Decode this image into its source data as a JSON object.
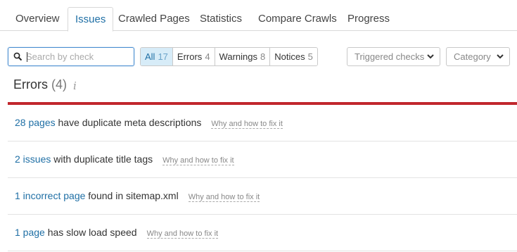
{
  "tabs": [
    {
      "label": "Overview"
    },
    {
      "label": "Issues"
    },
    {
      "label": "Crawled Pages"
    },
    {
      "label": "Statistics"
    },
    {
      "label": "Compare Crawls"
    },
    {
      "label": "Progress"
    }
  ],
  "search": {
    "placeholder": "Search by check"
  },
  "filters": [
    {
      "label": "All",
      "count": "17"
    },
    {
      "label": "Errors",
      "count": "4"
    },
    {
      "label": "Warnings",
      "count": "8"
    },
    {
      "label": "Notices",
      "count": "5"
    }
  ],
  "dropdowns": {
    "triggered": "Triggered checks",
    "category": "Category"
  },
  "section": {
    "title": "Errors",
    "count": "(4)",
    "info": "i"
  },
  "issues": [
    {
      "link": "28 pages",
      "rest": " have duplicate meta descriptions",
      "fix": "Why and how to fix it"
    },
    {
      "link": "2 issues",
      "rest": " with duplicate title tags",
      "fix": "Why and how to fix it"
    },
    {
      "link": "1 incorrect page",
      "rest": " found in sitemap.xml",
      "fix": "Why and how to fix it"
    },
    {
      "link": "1 page",
      "rest": " has slow load speed",
      "fix": "Why and how to fix it"
    }
  ],
  "colors": {
    "accent": "#1f6fa5",
    "error_bar": "#c1272d",
    "active_filter_bg": "#d7ecf8"
  }
}
